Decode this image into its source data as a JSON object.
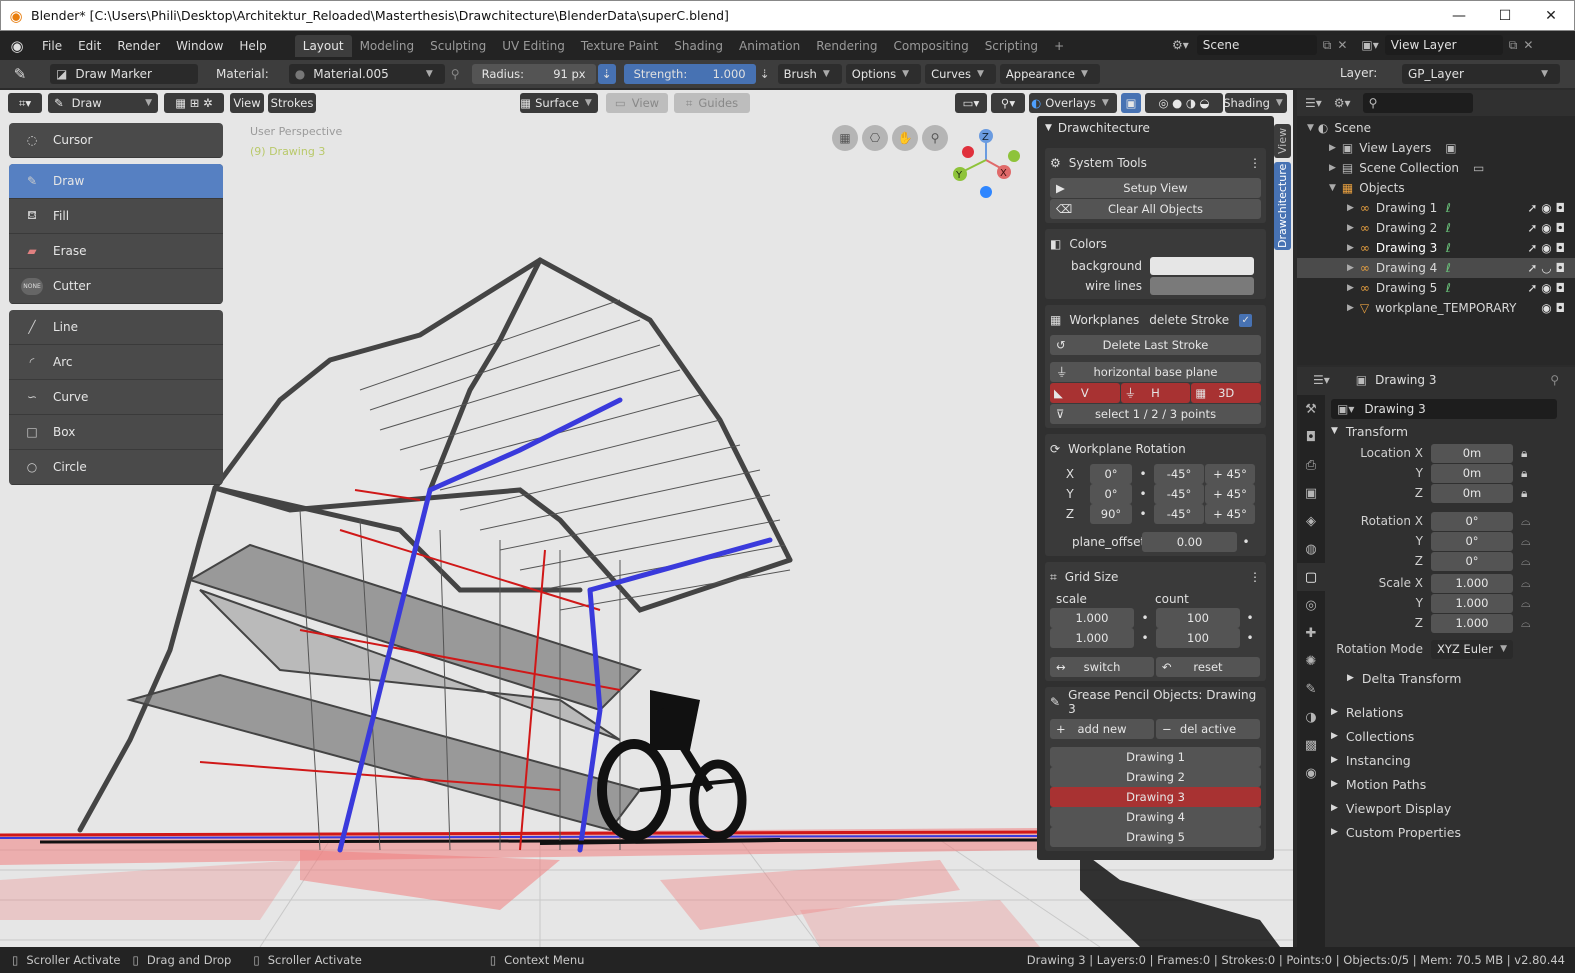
{
  "window": {
    "title": "Blender* [C:\\Users\\Phili\\Desktop\\Architektur_Reloaded\\Masterthesis\\Drawchitecture\\BlenderData\\superC.blend]",
    "minimize": "—",
    "maximize": "☐",
    "close": "✕"
  },
  "menu": {
    "items": [
      "File",
      "Edit",
      "Render",
      "Window",
      "Help"
    ],
    "workspaces": [
      "Layout",
      "Modeling",
      "Sculpting",
      "UV Editing",
      "Texture Paint",
      "Shading",
      "Animation",
      "Rendering",
      "Compositing",
      "Scripting"
    ],
    "active_workspace": "Layout",
    "scene": "Scene",
    "view_layer": "View Layer"
  },
  "tool_header": {
    "brush": "Draw Marker",
    "material_label": "Material:",
    "material": "Material.005",
    "radius_label": "Radius:",
    "radius": "91 px",
    "strength_label": "Strength:",
    "strength": "1.000",
    "strength_fill": 1.0,
    "menus": [
      "Brush",
      "Options",
      "Curves",
      "Appearance"
    ],
    "layer_label": "Layer:",
    "layer": "GP_Layer"
  },
  "viewport_header": {
    "mode": "Draw",
    "view": "View",
    "strokes": "Strokes",
    "placement": "Surface",
    "view2": "View",
    "guides": "Guides",
    "overlays": "Overlays",
    "shading": "Shading"
  },
  "viewport": {
    "perspective": "User Perspective",
    "object": "(9) Drawing 3",
    "axes": {
      "z": "Z",
      "y": "Y",
      "x": "X"
    }
  },
  "tools": {
    "group1": [
      {
        "label": "Cursor",
        "icon": "cursor-icon",
        "selected": false
      }
    ],
    "group2": [
      {
        "label": "Draw",
        "icon": "draw-icon",
        "selected": true
      },
      {
        "label": "Fill",
        "icon": "fill-icon",
        "selected": false
      },
      {
        "label": "Erase",
        "icon": "erase-icon",
        "selected": false
      },
      {
        "label": "Cutter",
        "icon": "cutter-icon",
        "selected": false
      }
    ],
    "group3": [
      {
        "label": "Line",
        "icon": "line-icon",
        "selected": false
      },
      {
        "label": "Arc",
        "icon": "arc-icon",
        "selected": false
      },
      {
        "label": "Curve",
        "icon": "curve-icon",
        "selected": false
      },
      {
        "label": "Box",
        "icon": "box-icon",
        "selected": false
      },
      {
        "label": "Circle",
        "icon": "circle-icon",
        "selected": false
      }
    ],
    "cutter_badge": "NONE"
  },
  "npanel": {
    "title": "Drawchitecture",
    "tabs": [
      "View",
      "Drawchitecture"
    ],
    "system_tools": {
      "label": "System Tools",
      "setup_view": "Setup View",
      "clear_all": "Clear All Objects"
    },
    "colors": {
      "label": "Colors",
      "background": "background",
      "wire_lines": "wire lines",
      "background_color": "#e6e6e6",
      "wire_color": "#7a7a7a"
    },
    "workplanes": {
      "label": "Workplanes",
      "delete_stroke": "delete Stroke",
      "delete_last": "Delete Last Stroke",
      "horizontal": "horizontal base plane",
      "v": "V",
      "h": "H",
      "three_d": "3D",
      "select_points": "select 1 / 2 / 3 points"
    },
    "rotation": {
      "label": "Workplane Rotation",
      "rows": [
        {
          "axis": "X",
          "value": "0°",
          "minus": "-45°",
          "plus": "+ 45°"
        },
        {
          "axis": "Y",
          "value": "0°",
          "minus": "-45°",
          "plus": "+ 45°"
        },
        {
          "axis": "Z",
          "value": "90°",
          "minus": "-45°",
          "plus": "+ 45°"
        }
      ],
      "offset_label": "plane_offset",
      "offset": "0.00"
    },
    "grid": {
      "label": "Grid Size",
      "scale_label": "scale",
      "count_label": "count",
      "scale1": "1.000",
      "scale2": "1.000",
      "count1": "100",
      "count2": "100",
      "switch": "switch",
      "reset": "reset"
    },
    "gp_objects": {
      "label": "Grease Pencil Objects: Drawing 3",
      "add_new": "add new",
      "del_active": "del active",
      "items": [
        "Drawing 1",
        "Drawing 2",
        "Drawing 3",
        "Drawing 4",
        "Drawing 5"
      ],
      "active": "Drawing 3"
    }
  },
  "outliner": {
    "scene": "Scene",
    "view_layers": "View Layers",
    "scene_collection": "Scene Collection",
    "objects": "Objects",
    "items": [
      "Drawing 1",
      "Drawing 2",
      "Drawing 3",
      "Drawing 4",
      "Drawing 5",
      "workplane_TEMPORARY"
    ]
  },
  "properties": {
    "object": "Drawing 3",
    "object_field": "Drawing 3",
    "transform": "Transform",
    "location_label": "Location X",
    "location": [
      "0m",
      "0m",
      "0m"
    ],
    "rotation_label": "Rotation X",
    "rotation": [
      "0°",
      "0°",
      "0°"
    ],
    "scale_label": "Scale X",
    "scale": [
      "1.000",
      "1.000",
      "1.000"
    ],
    "axis_y": "Y",
    "axis_z": "Z",
    "rotation_mode_label": "Rotation Mode",
    "rotation_mode": "XYZ Euler",
    "delta": "Delta Transform",
    "panels": [
      "Relations",
      "Collections",
      "Instancing",
      "Motion Paths",
      "Viewport Display",
      "Custom Properties"
    ]
  },
  "status": {
    "hints": [
      "Scroller Activate",
      "Drag and Drop",
      "Scroller Activate",
      "Context Menu"
    ],
    "info": "Drawing 3 | Layers:0 | Frames:0 | Strokes:0 | Points:0 | Objects:0/5 | Mem: 70.5 MB | v2.80.44"
  }
}
